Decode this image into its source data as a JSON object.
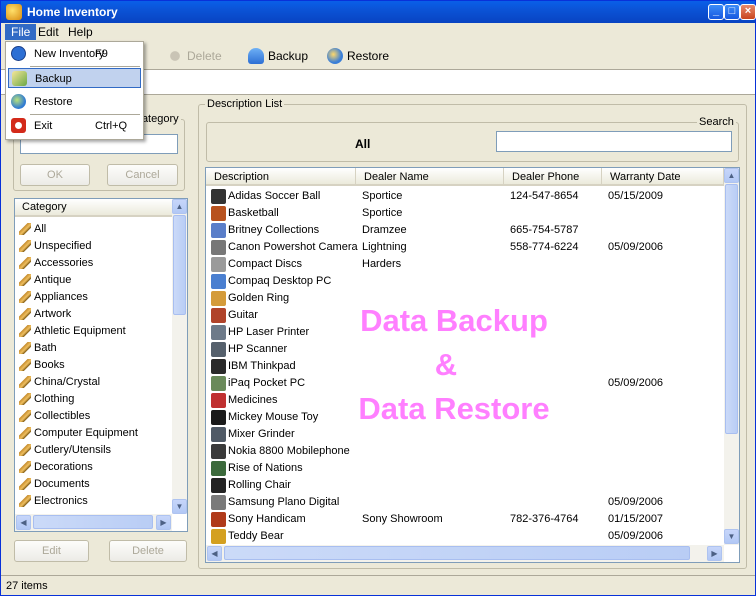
{
  "window": {
    "title": "Home Inventory"
  },
  "menubar": [
    {
      "label": "File"
    },
    {
      "label": "Edit"
    },
    {
      "label": "Help"
    }
  ],
  "toolbar": {
    "delete_label": "Delete",
    "backup_label": "Backup",
    "restore_label": "Restore"
  },
  "file_menu": [
    {
      "label": "New Inventory",
      "shortcut": "F9"
    },
    {
      "label": "Backup",
      "shortcut": ""
    },
    {
      "label": "Restore",
      "shortcut": ""
    },
    {
      "label": "Exit",
      "shortcut": "Ctrl+Q"
    }
  ],
  "category_panel": {
    "legend": "Category",
    "ok_label": "OK",
    "cancel_label": "Cancel",
    "list_header": "Category",
    "items": [
      "All",
      "Unspecified",
      "Accessories",
      "Antique",
      "Appliances",
      "Artwork",
      "Athletic Equipment",
      "Bath",
      "Books",
      "China/Crystal",
      "Clothing",
      "Collectibles",
      "Computer Equipment",
      "Cutlery/Utensils",
      "Decorations",
      "Documents",
      "Electronics"
    ],
    "edit_label": "Edit",
    "delete_label": "Delete"
  },
  "description_panel": {
    "legend": "Description List",
    "filter_label": "All",
    "search_legend": "Search",
    "columns": [
      "Description",
      "Dealer Name",
      "Dealer Phone",
      "Warranty Date"
    ],
    "rows": [
      {
        "desc": "Adidas Soccer Ball",
        "dealer": "Sportice",
        "phone": "124-547-8654",
        "date": "05/15/2009",
        "color": "#333333"
      },
      {
        "desc": "Basketball",
        "dealer": "Sportice",
        "phone": "",
        "date": "",
        "color": "#b8521e"
      },
      {
        "desc": "Britney Collections",
        "dealer": "Dramzee",
        "phone": "665-754-5787",
        "date": "",
        "color": "#5a7ec9"
      },
      {
        "desc": "Canon Powershot Camera",
        "dealer": "Lightning",
        "phone": "558-774-6224",
        "date": "05/09/2006",
        "color": "#777777"
      },
      {
        "desc": "Compact Discs",
        "dealer": "Harders",
        "phone": "",
        "date": "",
        "color": "#9a9a9a"
      },
      {
        "desc": "Compaq Desktop PC",
        "dealer": "",
        "phone": "",
        "date": "",
        "color": "#4a7fd0"
      },
      {
        "desc": "Golden Ring",
        "dealer": "",
        "phone": "",
        "date": "",
        "color": "#d49b3a"
      },
      {
        "desc": "Guitar",
        "dealer": "",
        "phone": "",
        "date": "",
        "color": "#b0432a"
      },
      {
        "desc": "HP Laser Printer",
        "dealer": "",
        "phone": "",
        "date": "",
        "color": "#6d7a89"
      },
      {
        "desc": "HP Scanner",
        "dealer": "",
        "phone": "",
        "date": "",
        "color": "#55606c"
      },
      {
        "desc": "IBM Thinkpad",
        "dealer": "",
        "phone": "",
        "date": "",
        "color": "#2a2a2a"
      },
      {
        "desc": "iPaq Pocket PC",
        "dealer": "",
        "phone": "",
        "date": "05/09/2006",
        "color": "#6a8a5a"
      },
      {
        "desc": "Medicines",
        "dealer": "",
        "phone": "",
        "date": "",
        "color": "#c03030"
      },
      {
        "desc": "Mickey Mouse Toy",
        "dealer": "",
        "phone": "",
        "date": "",
        "color": "#1a1a1a"
      },
      {
        "desc": "Mixer Grinder",
        "dealer": "",
        "phone": "",
        "date": "",
        "color": "#505a66"
      },
      {
        "desc": "Nokia 8800 Mobilephone",
        "dealer": "",
        "phone": "",
        "date": "",
        "color": "#3a3a3a"
      },
      {
        "desc": "Rise of Nations",
        "dealer": "",
        "phone": "",
        "date": "",
        "color": "#3c6a3c"
      },
      {
        "desc": "Rolling Chair",
        "dealer": "",
        "phone": "",
        "date": "",
        "color": "#222222"
      },
      {
        "desc": "Samsung Plano Digital",
        "dealer": "",
        "phone": "",
        "date": "05/09/2006",
        "color": "#7a7a7a"
      },
      {
        "desc": "Sony Handicam",
        "dealer": "Sony Showroom",
        "phone": "782-376-4764",
        "date": "01/15/2007",
        "color": "#b03a1a"
      },
      {
        "desc": "Teddy Bear",
        "dealer": "",
        "phone": "",
        "date": "05/09/2006",
        "color": "#d4a020"
      }
    ]
  },
  "watermark": {
    "line1": "Data Backup",
    "line2": "&",
    "line3": "Data Restore"
  },
  "status": {
    "count": "27 items"
  },
  "colors": {
    "accent": "#316ac5",
    "title": "#0b53d6",
    "watermark": "#ff7fff"
  }
}
